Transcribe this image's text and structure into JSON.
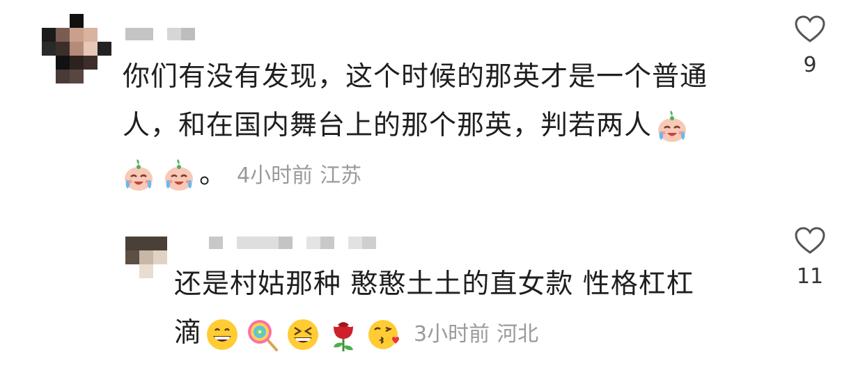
{
  "comments": [
    {
      "line1": "你们有没有发现，这个时候的那英才是一个普通",
      "line2": "人，和在国内舞台上的那个那英，判若两人",
      "line3_tail": "。",
      "time": "4小时前",
      "location": "江苏",
      "likes": "9",
      "icons": [
        "crying-laughing-baby-icon",
        "crying-laughing-baby-icon",
        "crying-laughing-baby-icon"
      ]
    },
    {
      "line1": "还是村姑那种 憨憨土土的直女款 性格杠杠",
      "line2_head": "滴",
      "time": "3小时前",
      "location": "河北",
      "likes": "11",
      "icons": [
        "grinning-face-icon",
        "lollipop-icon",
        "laughing-squint-face-icon",
        "rose-icon",
        "kissing-face-icon"
      ]
    }
  ]
}
